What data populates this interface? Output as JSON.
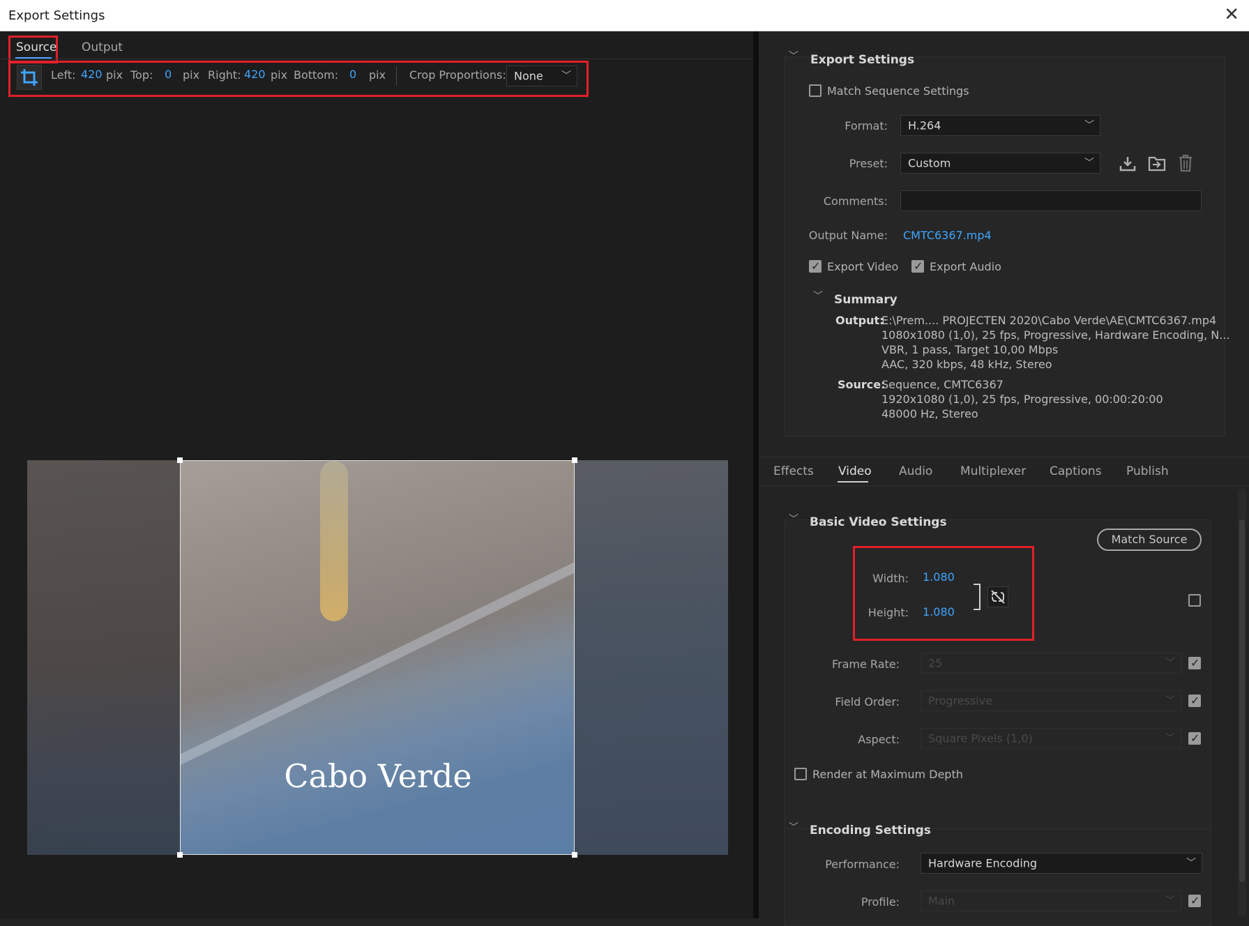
{
  "window": {
    "title": "Export Settings",
    "close_glyph": "✕"
  },
  "left": {
    "tabs": [
      {
        "label": "Source",
        "active": true
      },
      {
        "label": "Output",
        "active": false
      }
    ],
    "crop": {
      "left_label": "Left:",
      "left_value": "420",
      "left_unit": "pix",
      "top_label": "Top:",
      "top_value": "0",
      "top_unit": "pix",
      "right_label": "Right:",
      "right_value": "420",
      "right_unit": "pix",
      "bottom_label": "Bottom:",
      "bottom_value": "0",
      "bottom_unit": "pix",
      "proportions_label": "Crop Proportions:",
      "proportions_value": "None"
    },
    "preview": {
      "caption": "Cabo Verde"
    }
  },
  "export_settings": {
    "header": "Export Settings",
    "match_sequence": {
      "label": "Match Sequence Settings",
      "checked": false
    },
    "format": {
      "label": "Format:",
      "value": "H.264"
    },
    "preset": {
      "label": "Preset:",
      "value": "Custom"
    },
    "comments": {
      "label": "Comments:",
      "value": ""
    },
    "output_name": {
      "label": "Output Name:",
      "value": "CMTC6367.mp4"
    },
    "export_video": {
      "label": "Export Video",
      "checked": true
    },
    "export_audio": {
      "label": "Export Audio",
      "checked": true
    },
    "summary": {
      "header": "Summary",
      "output_label": "Output:",
      "output_lines": [
        "E:\\Prem.... PROJECTEN 2020\\Cabo Verde\\AE\\CMTC6367.mp4",
        "1080x1080 (1,0), 25 fps, Progressive, Hardware Encoding, N...",
        "VBR, 1 pass, Target 10,00 Mbps",
        "AAC, 320 kbps, 48 kHz, Stereo"
      ],
      "source_label": "Source:",
      "source_lines": [
        "Sequence, CMTC6367",
        "1920x1080 (1,0), 25 fps, Progressive, 00:00:20:00",
        "48000 Hz, Stereo"
      ]
    }
  },
  "bottom_tabs": [
    {
      "label": "Effects",
      "active": false
    },
    {
      "label": "Video",
      "active": true
    },
    {
      "label": "Audio",
      "active": false
    },
    {
      "label": "Multiplexer",
      "active": false
    },
    {
      "label": "Captions",
      "active": false
    },
    {
      "label": "Publish",
      "active": false
    }
  ],
  "basic_video": {
    "header": "Basic Video Settings",
    "match_source": "Match Source",
    "width": {
      "label": "Width:",
      "value": "1.080"
    },
    "height": {
      "label": "Height:",
      "value": "1.080"
    },
    "frame_rate": {
      "label": "Frame Rate:",
      "value": "25"
    },
    "field_order": {
      "label": "Field Order:",
      "value": "Progressive"
    },
    "aspect": {
      "label": "Aspect:",
      "value": "Square Pixels (1,0)"
    },
    "render_max_depth": {
      "label": "Render at Maximum Depth",
      "checked": false
    }
  },
  "encoding": {
    "header": "Encoding Settings",
    "performance": {
      "label": "Performance:",
      "value": "Hardware Encoding"
    },
    "profile": {
      "label": "Profile:",
      "value": "Main"
    }
  },
  "colors": {
    "accent": "#3ea6ff",
    "highlight_box": "#e1202a",
    "panel_bg": "#232323"
  }
}
